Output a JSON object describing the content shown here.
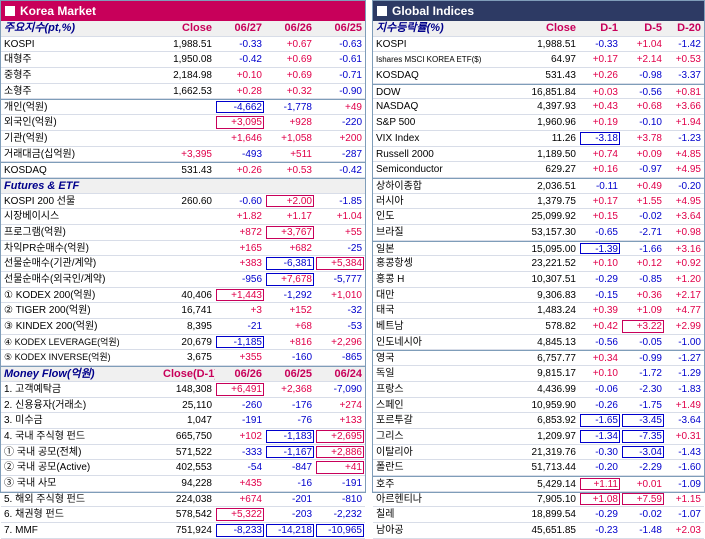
{
  "korea": {
    "title": "Korea Market",
    "sections": [
      {
        "header": [
          "주요지수(pt,%)",
          "Close",
          "06/27",
          "06/26",
          "06/25"
        ],
        "rows": [
          [
            "KOSPI",
            "1,988.51",
            "-0.33",
            "+0.67",
            "-0.63"
          ],
          [
            "대형주",
            "1,950.08",
            "-0.42",
            "+0.69",
            "-0.61"
          ],
          [
            "중형주",
            "2,184.98",
            "+0.10",
            "+0.69",
            "-0.71"
          ],
          [
            "소형주",
            "1,662.53",
            "+0.28",
            "+0.32",
            "-0.90"
          ],
          [
            "개인(억원)",
            "",
            "-4,662",
            "-1,778",
            "+49"
          ],
          [
            "외국인(억원)",
            "",
            "+3,095",
            "+928",
            "-220"
          ],
          [
            "기관(억원)",
            "",
            "+1,646",
            "+1,058",
            "+200"
          ],
          [
            "거래대금(십억원)",
            "+3,395",
            "-493",
            "+511",
            "-287"
          ],
          [
            "KOSDAQ",
            "531.43",
            "+0.26",
            "+0.53",
            "-0.42"
          ]
        ]
      },
      {
        "header": [
          "Futures & ETF",
          "",
          "",
          "",
          ""
        ],
        "rows": [
          [
            "KOSPI 200 선물",
            "260.60",
            "-0.60",
            "+2.00",
            "-1.85"
          ],
          [
            "시장베이시스",
            "",
            "+1.82",
            "+1.17",
            "+1.04"
          ],
          [
            "프로그램(억원)",
            "",
            "+872",
            "+3,767",
            "+55"
          ],
          [
            "차익PR순매수(억원)",
            "",
            "+165",
            "+682",
            "-25"
          ],
          [
            "선물순매수(기관/계약)",
            "",
            "+383",
            "-6,381",
            "+5,384"
          ],
          [
            "선물순매수(외국인/계약)",
            "",
            "-956",
            "+7,678",
            "-5,777"
          ],
          [
            "① KODEX 200(억원)",
            "40,406",
            "+1,443",
            "-1,292",
            "+1,010"
          ],
          [
            "② TIGER 200(억원)",
            "16,741",
            "+3",
            "+152",
            "-32"
          ],
          [
            "③ KINDEX 200(억원)",
            "8,395",
            "-21",
            "+68",
            "-53"
          ],
          [
            "④ KODEX LEVERAGE(억원)",
            "20,679",
            "-1,185",
            "+816",
            "+2,296"
          ],
          [
            "⑤ KODEX INVERSE(억원)",
            "3,675",
            "+355",
            "-160",
            "-865"
          ]
        ]
      },
      {
        "header": [
          "Money Flow(억원)",
          "Close(D-1)",
          "06/26",
          "06/25",
          "06/24"
        ],
        "rows": [
          [
            "1. 고객예탁금",
            "148,308",
            "+6,491",
            "+2,368",
            "-7,090"
          ],
          [
            "2. 신용융자(거래소)",
            "25,110",
            "-260",
            "-176",
            "+274"
          ],
          [
            "3. 미수금",
            "1,047",
            "-191",
            "-76",
            "+133"
          ],
          [
            "4. 국내 주식형 펀드",
            "665,750",
            "+102",
            "-1,183",
            "+2,695"
          ],
          [
            "  ① 국내 공모(전체)",
            "571,522",
            "-333",
            "-1,167",
            "+2,886"
          ],
          [
            "  ② 국내 공모(Active)",
            "402,553",
            "-54",
            "-847",
            "+41"
          ],
          [
            "  ③ 국내 사모",
            "94,228",
            "+435",
            "-16",
            "-191"
          ],
          [
            "5. 해외 주식형 펀드",
            "224,038",
            "+674",
            "-201",
            "-810"
          ],
          [
            "6. 채권형 펀드",
            "578,542",
            "+5,322",
            "-203",
            "-2,232"
          ],
          [
            "7. MMF",
            "751,924",
            "-8,233",
            "-14,218",
            "-10,965"
          ]
        ]
      }
    ]
  },
  "global": {
    "title": "Global Indices",
    "header": [
      "지수등락률(%)",
      "Close",
      "D-1",
      "D-5",
      "D-20"
    ],
    "rows": [
      [
        "KOSPI",
        "1,988.51",
        "-0.33",
        "+1.04",
        "-1.42"
      ],
      [
        "Ishares MSCI KOREA ETF($)",
        "64.97",
        "+0.17",
        "+2.14",
        "+0.53"
      ],
      [
        "KOSDAQ",
        "531.43",
        "+0.26",
        "-0.98",
        "-3.37"
      ],
      [
        "DOW",
        "16,851.84",
        "+0.03",
        "-0.56",
        "+0.81"
      ],
      [
        "NASDAQ",
        "4,397.93",
        "+0.43",
        "+0.68",
        "+3.66"
      ],
      [
        "S&P 500",
        "1,960.96",
        "+0.19",
        "-0.10",
        "+1.94"
      ],
      [
        "VIX Index",
        "11.26",
        "-3.18",
        "+3.78",
        "-1.23"
      ],
      [
        "Russell 2000",
        "1,189.50",
        "+0.74",
        "+0.09",
        "+4.85"
      ],
      [
        "Semiconductor",
        "629.27",
        "+0.16",
        "-0.97",
        "+4.95"
      ],
      [
        "상하이종합",
        "2,036.51",
        "-0.11",
        "+0.49",
        "-0.20"
      ],
      [
        "러시아",
        "1,379.75",
        "+0.17",
        "+1.55",
        "+4.95"
      ],
      [
        "인도",
        "25,099.92",
        "+0.15",
        "-0.02",
        "+3.64"
      ],
      [
        "브라질",
        "53,157.30",
        "-0.65",
        "-2.71",
        "+0.98"
      ],
      [
        "일본",
        "15,095.00",
        "-1.39",
        "-1.66",
        "+3.16"
      ],
      [
        "홍콩항셍",
        "23,221.52",
        "+0.10",
        "+0.12",
        "+0.92"
      ],
      [
        "홍콩 H",
        "10,307.51",
        "-0.29",
        "-0.85",
        "+1.20"
      ],
      [
        "대만",
        "9,306.83",
        "-0.15",
        "+0.36",
        "+2.17"
      ],
      [
        "태국",
        "1,483.24",
        "+0.39",
        "+1.09",
        "+4.77"
      ],
      [
        "베트남",
        "578.82",
        "+0.42",
        "+3.22",
        "+2.99"
      ],
      [
        "인도네시아",
        "4,845.13",
        "-0.56",
        "-0.05",
        "-1.00"
      ],
      [
        "영국",
        "6,757.77",
        "+0.34",
        "-0.99",
        "-1.27"
      ],
      [
        "독일",
        "9,815.17",
        "+0.10",
        "-1.72",
        "-1.29"
      ],
      [
        "프랑스",
        "4,436.99",
        "-0.06",
        "-2.30",
        "-1.83"
      ],
      [
        "스페인",
        "10,959.90",
        "-0.26",
        "-1.75",
        "+1.49"
      ],
      [
        "포르투갈",
        "6,853.92",
        "-1.65",
        "-3.45",
        "-3.64"
      ],
      [
        "그리스",
        "1,209.97",
        "-1.34",
        "-7.35",
        "+0.31"
      ],
      [
        "이탈리아",
        "21,319.76",
        "-0.30",
        "-3.04",
        "-1.43"
      ],
      [
        "폴란드",
        "51,713.44",
        "-0.20",
        "-2.29",
        "-1.60"
      ],
      [
        "호주",
        "5,429.14",
        "+1.11",
        "+0.01",
        "-1.09"
      ],
      [
        "아르헨티나",
        "7,905.10",
        "+1.08",
        "+7.59",
        "+1.15"
      ],
      [
        "칠레",
        "18,899.54",
        "-0.29",
        "-0.02",
        "-1.07"
      ],
      [
        "남아공",
        "45,651.85",
        "-0.23",
        "-1.48",
        "+2.03"
      ]
    ]
  }
}
